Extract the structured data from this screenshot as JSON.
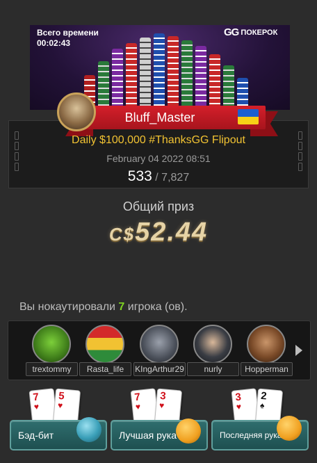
{
  "banner": {
    "timer_label": "Всего времени",
    "timer_value": "00:02:43",
    "brand_mark": "GG",
    "brand_name": "ПОКЕРОК"
  },
  "player": {
    "name": "Bluff_Master",
    "flag": "ukraine-flag-icon"
  },
  "tournament": {
    "name": "Daily $100,000 #ThanksGG Flipout",
    "date": "February 04 2022 08:51",
    "position": "533",
    "total": "/ 7,827"
  },
  "prize": {
    "label": "Общий приз",
    "currency": "C$",
    "amount": "52.44"
  },
  "knockouts": {
    "text_before": "Вы нокаутировали ",
    "count": "7",
    "text_after": " игрока (ов).",
    "players": [
      {
        "name": "trextommy",
        "icon": "dinosaur-avatar-icon",
        "color": "#5ba82f"
      },
      {
        "name": "Rasta_life",
        "icon": "rasta-palm-avatar-icon",
        "color": "#c62828"
      },
      {
        "name": "KIngArthur29",
        "icon": "gorilla-avatar-icon",
        "color": "#5a5f6a"
      },
      {
        "name": "nurly",
        "icon": "masked-man-avatar-icon",
        "color": "#3b3f46"
      },
      {
        "name": "Hopperman",
        "icon": "mustache-man-avatar-icon",
        "color": "#6b3a1f"
      }
    ]
  },
  "buttons": [
    {
      "label": "Бэд-бит",
      "icon": "crying-emoji-icon"
    },
    {
      "label": "Лучшая рука",
      "icon": "thumbs-up-emoji-icon"
    },
    {
      "label": "Последняя рука",
      "icon": "waving-emoji-icon"
    }
  ],
  "hands": [
    [
      {
        "rank": "7",
        "suit": "♥"
      },
      {
        "rank": "5",
        "suit": "♥"
      }
    ],
    [
      {
        "rank": "7",
        "suit": "♥"
      },
      {
        "rank": "3",
        "suit": "♥"
      }
    ],
    [
      {
        "rank": "3",
        "suit": "♥"
      },
      {
        "rank": "2",
        "suit": "♠"
      }
    ]
  ],
  "colors": {
    "accent_gold": "#f1c232",
    "ribbon_red": "#d41f2a",
    "knockout_green": "#7ed321",
    "button_teal": "#2f6e6e"
  }
}
